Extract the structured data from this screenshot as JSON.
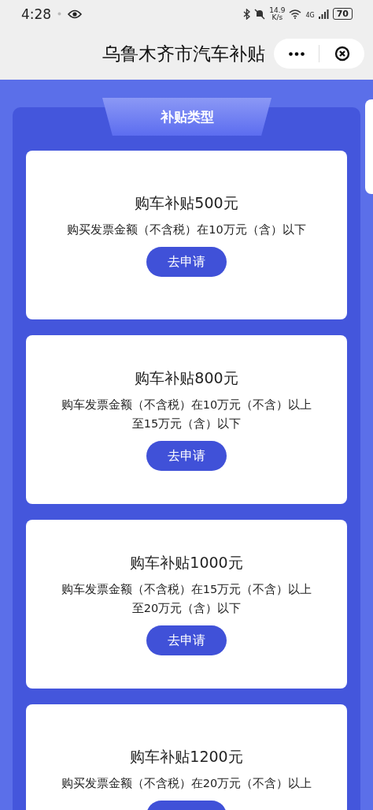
{
  "status_bar": {
    "time": "4:28",
    "speed_value": "14.9",
    "speed_unit": "K/s",
    "network": "4G",
    "battery": "70"
  },
  "header": {
    "title": "乌鲁木齐市汽车补贴"
  },
  "section": {
    "tab_label": "补贴类型"
  },
  "cards": [
    {
      "title": "购车补贴500元",
      "lines": [
        "购买发票金额（不含税）在10万元（含）以下"
      ],
      "button": "去申请"
    },
    {
      "title": "购车补贴800元",
      "lines": [
        "购车发票金额（不含税）在10万元（不含）以上",
        "至15万元（含）以下"
      ],
      "button": "去申请"
    },
    {
      "title": "购车补贴1000元",
      "lines": [
        "购车发票金额（不含税）在15万元（不含）以上",
        "至20万元（含）以下"
      ],
      "button": "去申请"
    },
    {
      "title": "购车补贴1200元",
      "lines": [
        "购买发票金额（不含税）在20万元（不含）以上"
      ]
    }
  ]
}
